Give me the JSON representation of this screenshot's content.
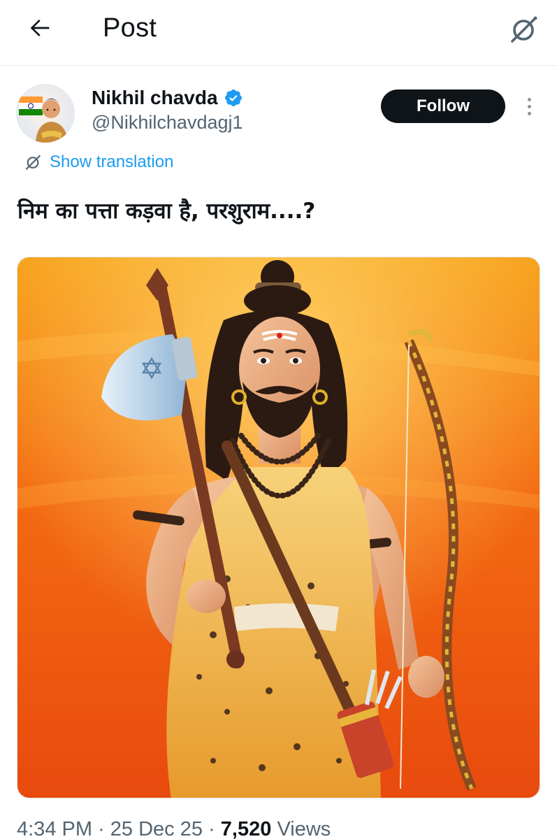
{
  "header": {
    "title": "Post",
    "back_icon": "arrow-left-icon",
    "grok_icon": "grok-icon"
  },
  "author": {
    "display_name": "Nikhil chavda",
    "handle": "@Nikhilchavdagj1",
    "verified": true,
    "verified_color": "#1d9bf0"
  },
  "actions": {
    "follow_label": "Follow"
  },
  "translation": {
    "label": "Show translation",
    "color": "#1d9bf0"
  },
  "post": {
    "text": "निम का पत्ता कड़वा है, परशुराम....?"
  },
  "media": {
    "alt": "Parshuram illustration with axe and bow on orange background"
  },
  "meta": {
    "time": "4:34 PM",
    "date": "25 Dec 25",
    "separator": "·",
    "views_count": "7,520",
    "views_label": "Views"
  }
}
